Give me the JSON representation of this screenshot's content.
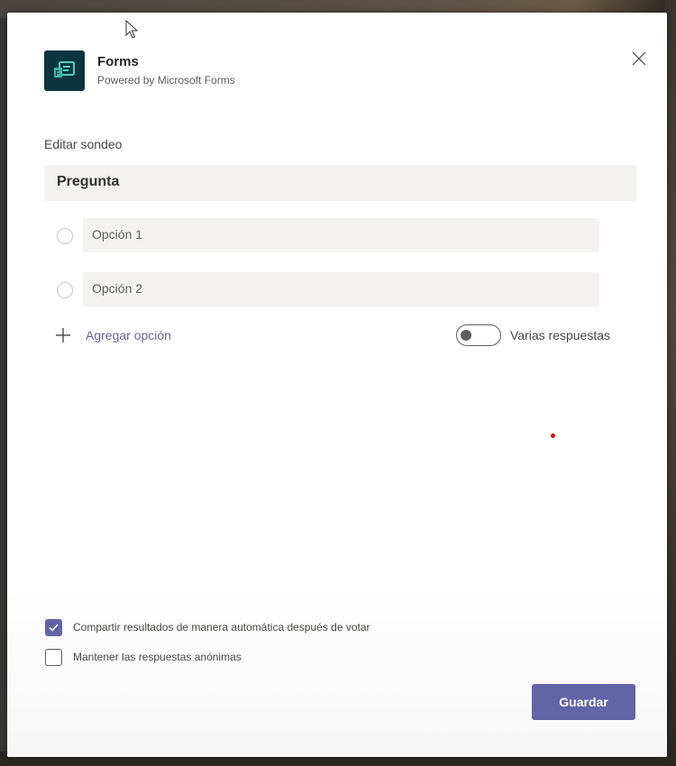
{
  "header": {
    "app_name": "Forms",
    "subtitle": "Powered by Microsoft Forms"
  },
  "editor": {
    "section_label": "Editar sondeo",
    "question": "Pregunta",
    "options": [
      {
        "label": "Opción 1",
        "selected": false
      },
      {
        "label": "Opción 2",
        "selected": false
      }
    ],
    "add_option_label": "Agregar opción",
    "multiple_answers": {
      "label": "Varias respuestas",
      "enabled": false
    }
  },
  "settings": {
    "share_results": {
      "label": "Compartir resultados de manera automática después de votar",
      "checked": true
    },
    "anonymous": {
      "label": "Mantener las respuestas anónimas",
      "checked": false
    }
  },
  "footer": {
    "save_label": "Guardar"
  },
  "icons": {
    "app": "forms-app-icon",
    "close": "close-icon",
    "add": "plus-icon",
    "check": "checkmark-icon"
  },
  "colors": {
    "accent": "#6264a7",
    "app_icon_bg": "#0b3440",
    "field_bg": "#f3f2f1"
  }
}
